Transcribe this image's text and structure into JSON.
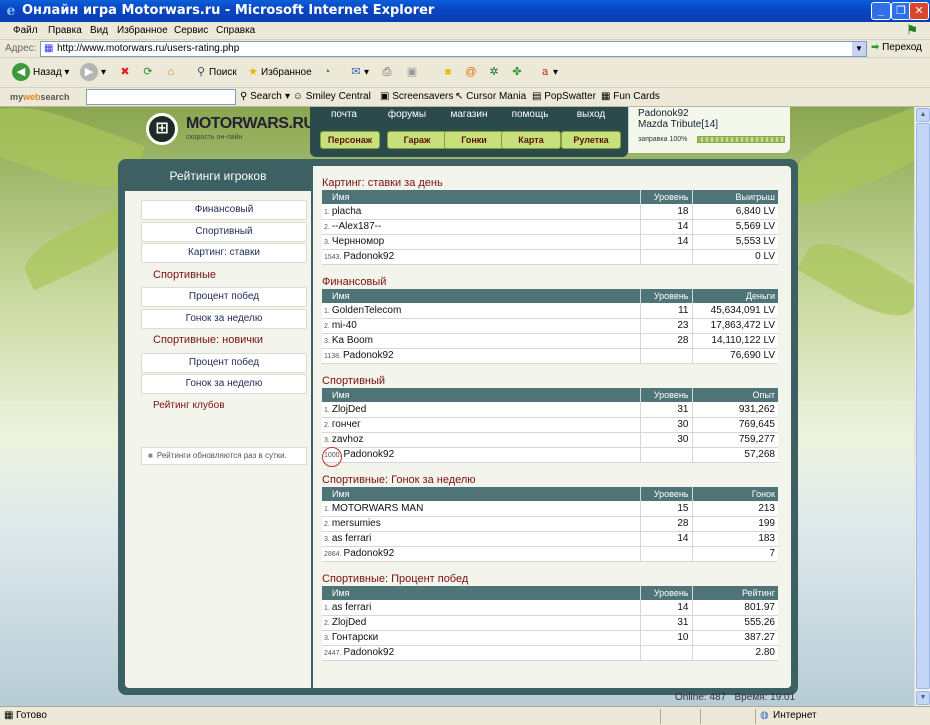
{
  "window": {
    "title": "Онлайн игра Motorwars.ru - Microsoft Internet Explorer"
  },
  "menu": [
    "Файл",
    "Правка",
    "Вид",
    "Избранное",
    "Сервис",
    "Справка"
  ],
  "address": {
    "label": "Адрес:",
    "url": "http://www.motorwars.ru/users-rating.php",
    "go": "Переход"
  },
  "toolbar": {
    "back": "Назад",
    "search": "Поиск",
    "favorites": "Избранное"
  },
  "searchbar": {
    "brand_prefix": "my",
    "brand_web": "web",
    "brand_suffix": "search",
    "search": "Search",
    "smiley": "Smiley Central",
    "screensavers": "Screensavers",
    "cursor": "Cursor Mania",
    "popswatter": "PopSwatter",
    "funcards": "Fun Cards"
  },
  "status": {
    "left": "Готово",
    "zone": "Интернет"
  },
  "site": {
    "logo_name": "MOTORWARS.RU",
    "logo_sub": "скорость он-лайн",
    "nav_top": [
      "почта",
      "форумы",
      "магазин",
      "помощь",
      "выход"
    ],
    "nav_buttons": [
      "Персонаж",
      "Гараж",
      "Гонки",
      "Карта",
      "Рулетка"
    ],
    "user": {
      "name": "Padonok92",
      "car": "Mazda Tribute[14]",
      "fuel_label": "заправка 100%",
      "fuel_level": 1.0
    }
  },
  "sidebar": {
    "title": "Рейтинги игроков",
    "item1": "Финансовый",
    "item2": "Спортивный",
    "item3": "Картинг: ставки",
    "head1": "Спортивные",
    "item4": "Процент побед",
    "item5": "Гонок за неделю",
    "head2": "Спортивные: новички",
    "item6": "Процент побед",
    "item7": "Гонок за неделю",
    "head3": "Рейтинг клубов",
    "note": "Рейтинги обновляются раз в сутки."
  },
  "sections": [
    {
      "title": "Картинг: ставки за день",
      "cols": [
        "Имя",
        "Уровень",
        "Выигрыш"
      ],
      "rows": [
        {
          "pos": "1.",
          "name": "placha",
          "level": "18",
          "value": "6,840 LV"
        },
        {
          "pos": "2.",
          "name": "--Alex187--",
          "level": "14",
          "value": "5,569 LV"
        },
        {
          "pos": "3.",
          "name": "Чернномор",
          "level": "14",
          "value": "5,553 LV"
        },
        {
          "pos": "1543.",
          "name": "Padonok92",
          "level": "",
          "value": "0 LV"
        }
      ]
    },
    {
      "title": "Финансовый",
      "cols": [
        "Имя",
        "Уровень",
        "Деньги"
      ],
      "rows": [
        {
          "pos": "1.",
          "name": "GoldenTelecom",
          "level": "11",
          "value": "45,634,091 LV"
        },
        {
          "pos": "2.",
          "name": "mi-40",
          "level": "23",
          "value": "17,863,472 LV"
        },
        {
          "pos": "3.",
          "name": "Ka Boom",
          "level": "28",
          "value": "14,110,122 LV"
        },
        {
          "pos": "1138.",
          "name": "Padonok92",
          "level": "",
          "value": "76,690 LV"
        }
      ]
    },
    {
      "title": "Спортивный",
      "cols": [
        "Имя",
        "Уровень",
        "Опыт"
      ],
      "rows": [
        {
          "pos": "1.",
          "name": "ZlojDed",
          "level": "31",
          "value": "931,262"
        },
        {
          "pos": "2.",
          "name": "гончег",
          "level": "30",
          "value": "769,645"
        },
        {
          "pos": "3.",
          "name": "zavhoz",
          "level": "30",
          "value": "759,277"
        },
        {
          "pos": "1000.",
          "name": "Padonok92",
          "level": "",
          "value": "57,268"
        }
      ]
    },
    {
      "title": "Спортивные: Гонок за неделю",
      "cols": [
        "Имя",
        "Уровень",
        "Гонок"
      ],
      "rows": [
        {
          "pos": "1.",
          "name": "MOTORWARS MAN",
          "level": "15",
          "value": "213"
        },
        {
          "pos": "2.",
          "name": "mersumies",
          "level": "28",
          "value": "199"
        },
        {
          "pos": "3.",
          "name": "as ferrari",
          "level": "14",
          "value": "183"
        },
        {
          "pos": "2864.",
          "name": "Padonok92",
          "level": "",
          "value": "7"
        }
      ]
    },
    {
      "title": "Спортивные: Процент побед",
      "cols": [
        "Имя",
        "Уровень",
        "Рейтинг"
      ],
      "rows": [
        {
          "pos": "1.",
          "name": "as ferrari",
          "level": "14",
          "value": "801.97"
        },
        {
          "pos": "2.",
          "name": "ZlojDed",
          "level": "31",
          "value": "555.26"
        },
        {
          "pos": "3.",
          "name": "Гонтарски",
          "level": "10",
          "value": "387.27"
        },
        {
          "pos": "2447.",
          "name": "Padonok92",
          "level": "",
          "value": "2.80"
        }
      ]
    }
  ],
  "footer": {
    "online": "Online: 487",
    "time": "Время: 19:01"
  },
  "colors": {
    "title_bg": "#0a46c4",
    "frame": "#3d6062",
    "section_title": "#7a1010",
    "nav_button": "#c8e07a"
  }
}
